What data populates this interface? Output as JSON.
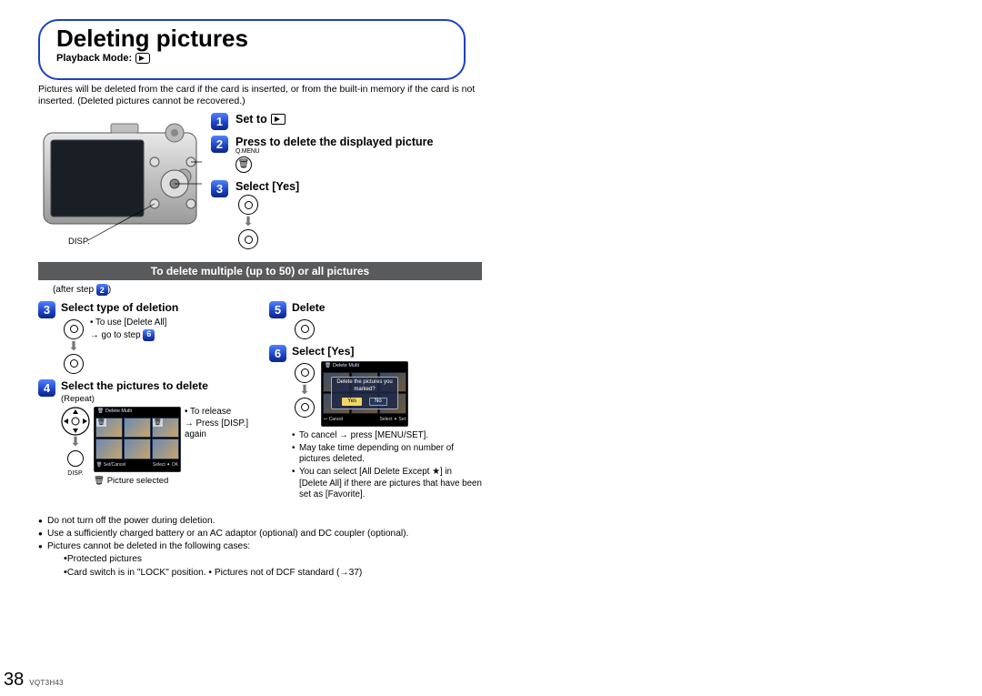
{
  "title": "Deleting pictures",
  "mode_label": "Playback Mode:",
  "intro": "Pictures will be deleted from the card if the card is inserted, or from the built-in memory if the card is not inserted. (Deleted pictures cannot be recovered.)",
  "disp_label": "DISP.",
  "steps": {
    "s1": "Set to",
    "s2": "Press to delete the displayed picture",
    "qmenu": "Q.MENU",
    "s3": "Select [Yes]"
  },
  "section_bar": "To delete multiple (up to 50) or all pictures",
  "after_step": "(after step     )",
  "after_step_num": "2",
  "lower": {
    "s3b": "Select type of deletion",
    "s3b_note1": "• To use [Delete All]",
    "s3b_note2": "→ go to step",
    "s3b_note2_num": "6",
    "s4": "Select the pictures to delete",
    "s4_repeat": "(Repeat)",
    "s4_release1": "• To release",
    "s4_release2": "→ Press [DISP.] again",
    "s4_caption": "Picture selected",
    "disp_tiny": "DISP.",
    "s5": "Delete",
    "s6": "Select [Yes]",
    "lcd_dialog": "Delete the pictures you marked?",
    "lcd_yes": "Yes",
    "lcd_no": "No",
    "lcd_cancel": "Cancel",
    "lcd_select": "Select",
    "lcd_set": "Set",
    "lcd_ok": "OK",
    "lcd_setcancel": "Set/Cancel",
    "lcd_title": "Delete Multi",
    "notes2_a": "To cancel → press [MENU/SET].",
    "notes2_b": "May take time depending on number of pictures deleted.",
    "notes2_c": "You can select [All Delete Except ★] in [Delete All] if there are pictures that have been set as [Favorite]."
  },
  "bullets": {
    "b1": "Do not turn off the power during deletion.",
    "b2": "Use a sufficiently charged battery or an AC adaptor (optional) and DC coupler (optional).",
    "b3": "Pictures cannot be deleted in the following cases:",
    "b3a": "Protected pictures",
    "b3b": "Card switch is in \"LOCK\" position. • Pictures not of DCF standard (→37)"
  },
  "page_number": "38",
  "doc_code": "VQT3H43"
}
